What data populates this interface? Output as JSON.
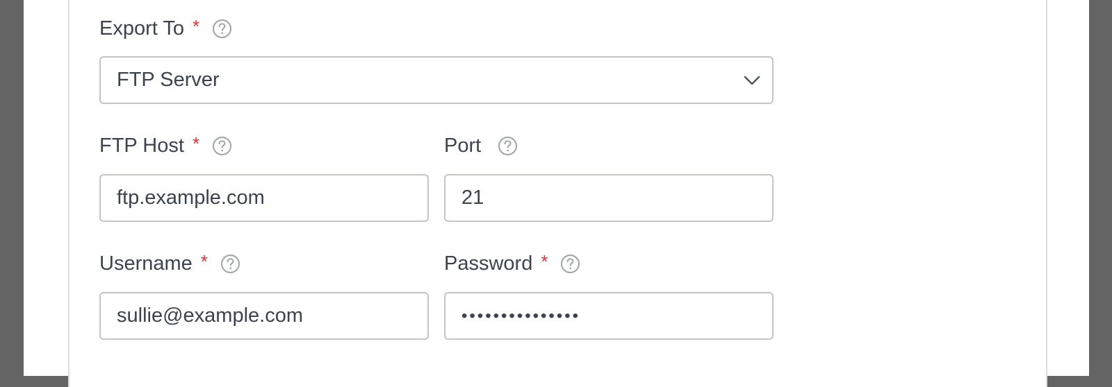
{
  "form": {
    "export_to": {
      "label": "Export To",
      "required_mark": "*",
      "selected": "FTP Server",
      "icon": "chevron-down-icon"
    },
    "ftp_host": {
      "label": "FTP Host",
      "required_mark": "*",
      "value": "ftp.example.com"
    },
    "port": {
      "label": "Port",
      "value": "21"
    },
    "username": {
      "label": "Username",
      "required_mark": "*",
      "value": "sullie@example.com"
    },
    "password": {
      "label": "Password",
      "required_mark": "*",
      "masked_value": "•••••••••••••••"
    },
    "help_icon": "question-circle-icon"
  },
  "colors": {
    "page_background": "#646464",
    "card_background": "#ffffff",
    "input_border": "#c3c4c7",
    "required": "#d63638",
    "text": "#3c434a",
    "help_icon": "#a7aaad"
  }
}
